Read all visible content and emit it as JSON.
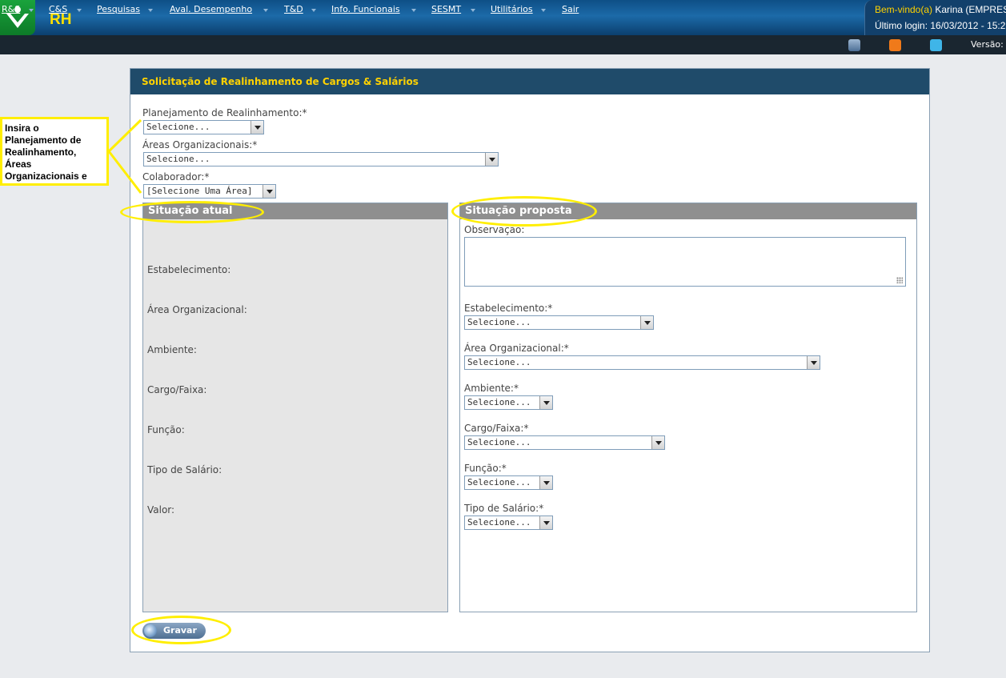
{
  "header": {
    "app_name": "RH",
    "welcome_label": "Bem-vindo(a)",
    "user_name": "Karina (EMPRES",
    "last_login": "Último login: 16/03/2012 - 15:2",
    "version_label": "Versão:"
  },
  "menu": [
    {
      "label": "R&S"
    },
    {
      "label": "C&S"
    },
    {
      "label": "Pesquisas"
    },
    {
      "label": "Aval. Desempenho"
    },
    {
      "label": "T&D"
    },
    {
      "label": "Info. Funcionais"
    },
    {
      "label": "SESMT"
    },
    {
      "label": "Utilitários"
    },
    {
      "label": "Sair"
    }
  ],
  "header_icons": [
    "video-icon",
    "blogger-icon",
    "twitter-icon"
  ],
  "panel": {
    "title": "Solicitação de Realinhamento de Cargos & Salários"
  },
  "form": {
    "planejamento_label": "Planejamento de Realinhamento:*",
    "planejamento_value": "Selecione...",
    "areas_label": "Áreas Organizacionais:*",
    "areas_value": "Selecione...",
    "colaborador_label": "Colaborador:*",
    "colaborador_value": "[Selecione Uma Área]"
  },
  "situacao_atual": {
    "title": "Situação atual",
    "fields": [
      "Estabelecimento:",
      "Área Organizacional:",
      "Ambiente:",
      "Cargo/Faixa:",
      "Função:",
      "Tipo de Salário:",
      "Valor:"
    ]
  },
  "situacao_proposta": {
    "title": "Situação proposta",
    "observacao_label": "Observação:",
    "observacao_value": "",
    "fields": [
      {
        "label": "Estabelecimento:*",
        "value": "Selecione..."
      },
      {
        "label": "Área Organizacional:*",
        "value": "Selecione..."
      },
      {
        "label": "Ambiente:*",
        "value": "Selecione..."
      },
      {
        "label": "Cargo/Faixa:*",
        "value": "Selecione..."
      },
      {
        "label": "Função:*",
        "value": "Selecione..."
      },
      {
        "label": "Tipo de Salário:*",
        "value": "Selecione..."
      }
    ]
  },
  "actions": {
    "save_label": "Gravar"
  },
  "annotation": {
    "callout_text": "Insira o Planejamento de Realinhamento, Áreas Organizacionais e Colaborador."
  },
  "colors": {
    "header_blue": "#1c6aa8",
    "menu_bg": "#1a2630",
    "title_bar": "#1f4b6a",
    "title_text": "#ffd200",
    "annotation_yellow": "#ffee00",
    "section_head": "#8f8f8f"
  }
}
